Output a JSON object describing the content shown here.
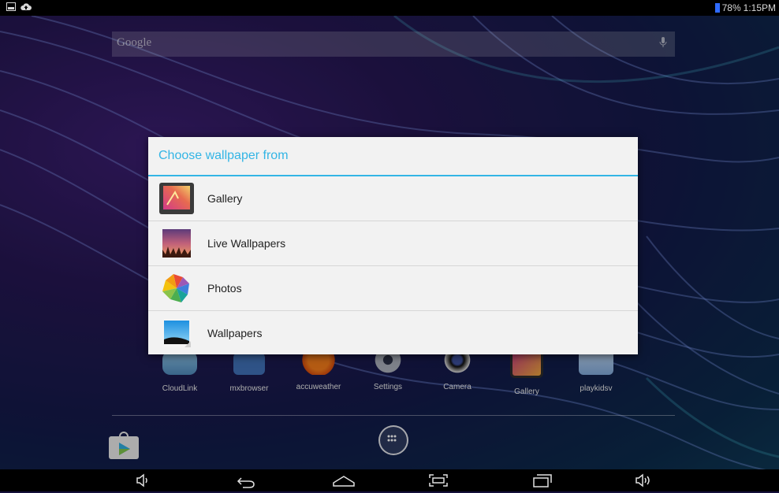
{
  "status_bar": {
    "battery": "78%",
    "time": "1:15PM",
    "battery_color": "#2f6bff"
  },
  "search": {
    "label": "Google"
  },
  "dialog": {
    "title": "Choose wallpaper from",
    "accent": "#33b5e5",
    "items": [
      {
        "label": "Gallery",
        "icon": "gallery-icon"
      },
      {
        "label": "Live Wallpapers",
        "icon": "live-wallpapers-icon"
      },
      {
        "label": "Photos",
        "icon": "photos-pinwheel-icon"
      },
      {
        "label": "Wallpapers",
        "icon": "wallpapers-icon"
      }
    ]
  },
  "home_apps": [
    {
      "label": "CloudLink"
    },
    {
      "label": "mxbrowser"
    },
    {
      "label": "accuweather"
    },
    {
      "label": "Settings"
    },
    {
      "label": "Camera"
    },
    {
      "label": "Gallery"
    },
    {
      "label": "playkidsv"
    }
  ],
  "nav_buttons": [
    "volume-down-icon",
    "back-icon",
    "home-icon",
    "screenshot-icon",
    "recent-apps-icon",
    "volume-up-icon"
  ]
}
